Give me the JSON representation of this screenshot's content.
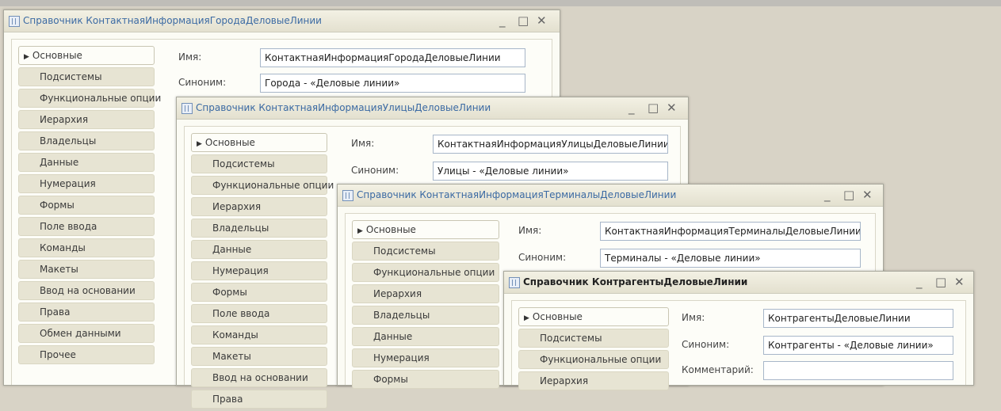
{
  "windows": [
    {
      "title": "Справочник КонтактнаяИнформацияГородаДеловыеЛинии",
      "tabs": [
        "Основные",
        "Подсистемы",
        "Функциональные опции",
        "Иерархия",
        "Владельцы",
        "Данные",
        "Нумерация",
        "Формы",
        "Поле ввода",
        "Команды",
        "Макеты",
        "Ввод на основании",
        "Права",
        "Обмен данными",
        "Прочее"
      ],
      "name_label": "Имя:",
      "name_value": "КонтактнаяИнформацияГородаДеловыеЛинии",
      "synonym_label": "Синоним:",
      "synonym_value": "Города - «Деловые линии»"
    },
    {
      "title": "Справочник КонтактнаяИнформацияУлицыДеловыеЛинии",
      "tabs": [
        "Основные",
        "Подсистемы",
        "Функциональные опции",
        "Иерархия",
        "Владельцы",
        "Данные",
        "Нумерация",
        "Формы",
        "Поле ввода",
        "Команды",
        "Макеты",
        "Ввод на основании",
        "Права"
      ],
      "name_label": "Имя:",
      "name_value": "КонтактнаяИнформацияУлицыДеловыеЛинии",
      "synonym_label": "Синоним:",
      "synonym_value": "Улицы - «Деловые линии»"
    },
    {
      "title": "Справочник КонтактнаяИнформацияТерминалыДеловыеЛинии",
      "tabs": [
        "Основные",
        "Подсистемы",
        "Функциональные опции",
        "Иерархия",
        "Владельцы",
        "Данные",
        "Нумерация",
        "Формы"
      ],
      "name_label": "Имя:",
      "name_value": "КонтактнаяИнформацияТерминалыДеловыеЛинии",
      "synonym_label": "Синоним:",
      "synonym_value": "Терминалы - «Деловые линии»"
    },
    {
      "title": "Справочник КонтрагентыДеловыеЛинии",
      "tabs": [
        "Основные",
        "Подсистемы",
        "Функциональные опции",
        "Иерархия"
      ],
      "name_label": "Имя:",
      "name_value": "КонтрагентыДеловыеЛинии",
      "synonym_label": "Синоним:",
      "synonym_value": "Контрагенты - «Деловые линии»",
      "comment_label": "Комментарий:",
      "comment_value": ""
    }
  ],
  "controls": {
    "minimize": "_",
    "maximize": "□",
    "close": "✕"
  },
  "icons": {
    "app": "table-icon",
    "selected_tab": "triangle-right-icon"
  }
}
